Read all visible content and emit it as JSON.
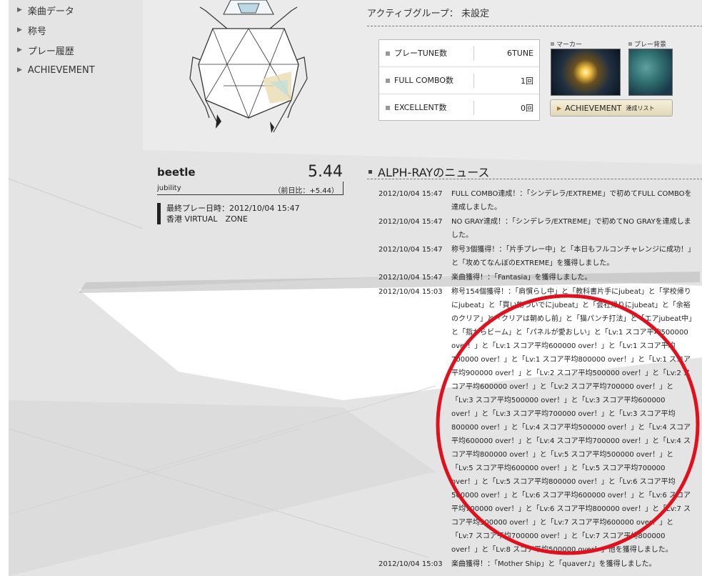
{
  "nav": {
    "items": [
      {
        "label": "楽曲データ"
      },
      {
        "label": "称号"
      },
      {
        "label": "プレー履歴"
      },
      {
        "label": "ACHIEVEMENT"
      }
    ]
  },
  "active_group": {
    "label": "アクティブグループ：",
    "value": "未設定"
  },
  "stats": [
    {
      "label": "プレーTUNE数",
      "value": "6TUNE"
    },
    {
      "label": "FULL COMBO数",
      "value": "1回"
    },
    {
      "label": "EXCELLENT数",
      "value": "0回"
    }
  ],
  "marker_label": "マーカー",
  "background_label": "プレー背景",
  "achievement_button": {
    "label": "ACHIEVEMENT",
    "sub": "達成リスト"
  },
  "player": {
    "name": "beetle",
    "score": "5.44",
    "jubility_label": "jubility",
    "diff": "（前日比：+5.44）",
    "last_play": "最終プレー日時：2012/10/04 15:47",
    "location": "香港 VIRTUAL　ZONE"
  },
  "news": {
    "title": "ALPH-RAYのニュース",
    "items": [
      {
        "date": "2012/10/04 15:47",
        "text": "FULL COMBO達成！：「シンデレラ/EXTREME」で初めてFULL COMBOを達成しました。"
      },
      {
        "date": "2012/10/04 15:47",
        "text": "NO GRAY達成！：「シンデレラ/EXTREME」で初めてNO GRAYを達成しました。"
      },
      {
        "date": "2012/10/04 15:47",
        "text": "称号3個獲得！：「片手プレー中」と「本日もフルコンチャレンジに成功！」と「攻めてなんぼのEXTREME」を獲得しました。"
      },
      {
        "date": "2012/10/04 15:47",
        "text": "楽曲獲得！：「Fantasia」を獲得しました。"
      },
      {
        "date": "2012/10/04 15:03",
        "text": "称号154個獲得！：「肩慣らし中」と「教科書片手にjubeat」と「学校帰りにjubeat」と「買い物ついでにjubeat」と「会社帰りにjubeat」と「余裕のクリア」と「クリアは朝めし前」と「猫パンチ打法」と「エアjubeat中」と「指からビーム」と「パネルが愛おしい」と「Lv:1 スコア平均500000 over！」と「Lv:1 スコア平均600000 over！」と「Lv:1 スコア平均700000 over！」と「Lv:1 スコア平均800000 over！」と「Lv:1 スコア平均900000 over！」と「Lv:2 スコア平均500000 over！」と「Lv:2 スコア平均600000 over！」と「Lv:2 スコア平均700000 over！」と「Lv:3 スコア平均500000 over！」と「Lv:3 スコア平均600000 over！」と「Lv:3 スコア平均700000 over！」と「Lv:3 スコア平均800000 over！」と「Lv:4 スコア平均500000 over！」と「Lv:4 スコア平均600000 over！」と「Lv:4 スコア平均700000 over！」と「Lv:4 スコア平均800000 over！」と「Lv:5 スコア平均500000 over！」と「Lv:5 スコア平均600000 over！」と「Lv:5 スコア平均700000 over！」と「Lv:5 スコア平均800000 over！」と「Lv:6 スコア平均500000 over！」と「Lv:6 スコア平均600000 over！」と「Lv:6 スコア平均700000 over！」と「Lv:6 スコア平均800000 over！」と「Lv:7 スコア平均500000 over！」と「Lv:7 スコア平均600000 over！」と「Lv:7 スコア平均700000 over！」と「Lv:7 スコア平均800000 over！」と「Lv:8 スコア平均500000 over！」他を獲得しました。"
      },
      {
        "date": "2012/10/04 15:03",
        "text": "楽曲獲得！：「Mother Ship」と「quaver♪」を獲得しました。"
      }
    ]
  },
  "colors": {
    "annotation_circle": "#e0101c"
  }
}
